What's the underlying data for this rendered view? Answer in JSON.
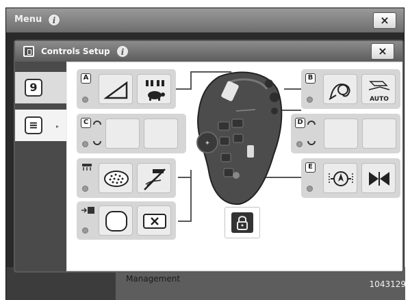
{
  "menu": {
    "title": "Menu",
    "info_symbol": "i",
    "close_symbol": "×",
    "background_text": "Management"
  },
  "dialog": {
    "title": "Controls Setup",
    "info_symbol": "i",
    "close_symbol": "×"
  },
  "side_tabs": [
    {
      "glyph": "9",
      "icon": "joystick-tab-icon",
      "selected": false
    },
    {
      "glyph": "≡",
      "icon": "list-tab-icon",
      "selected": true
    }
  ],
  "slots": {
    "A": {
      "letter": "A",
      "buttons": [
        "ramp-icon",
        "turtle-speed-icon"
      ]
    },
    "B": {
      "letter": "B",
      "buttons": [
        "steering-wheel-icon",
        "auto-icon"
      ]
    },
    "C": {
      "letter": "C",
      "buttons": [
        "empty",
        "empty"
      ]
    },
    "D": {
      "letter": "D",
      "buttons": [
        "empty",
        "empty"
      ]
    },
    "E": {
      "letter": "E",
      "buttons": [
        "center-point-icon",
        "bowtie-icon"
      ]
    },
    "F": {
      "buttons": [
        "field-grid-icon",
        "no-implement-icon"
      ]
    },
    "G": {
      "buttons": [
        "empty-rounded-icon",
        "cancel-x-icon"
      ]
    }
  },
  "auto_label": "AUTO",
  "lock_icon": "padlock-icon",
  "figure_id": "1043129"
}
